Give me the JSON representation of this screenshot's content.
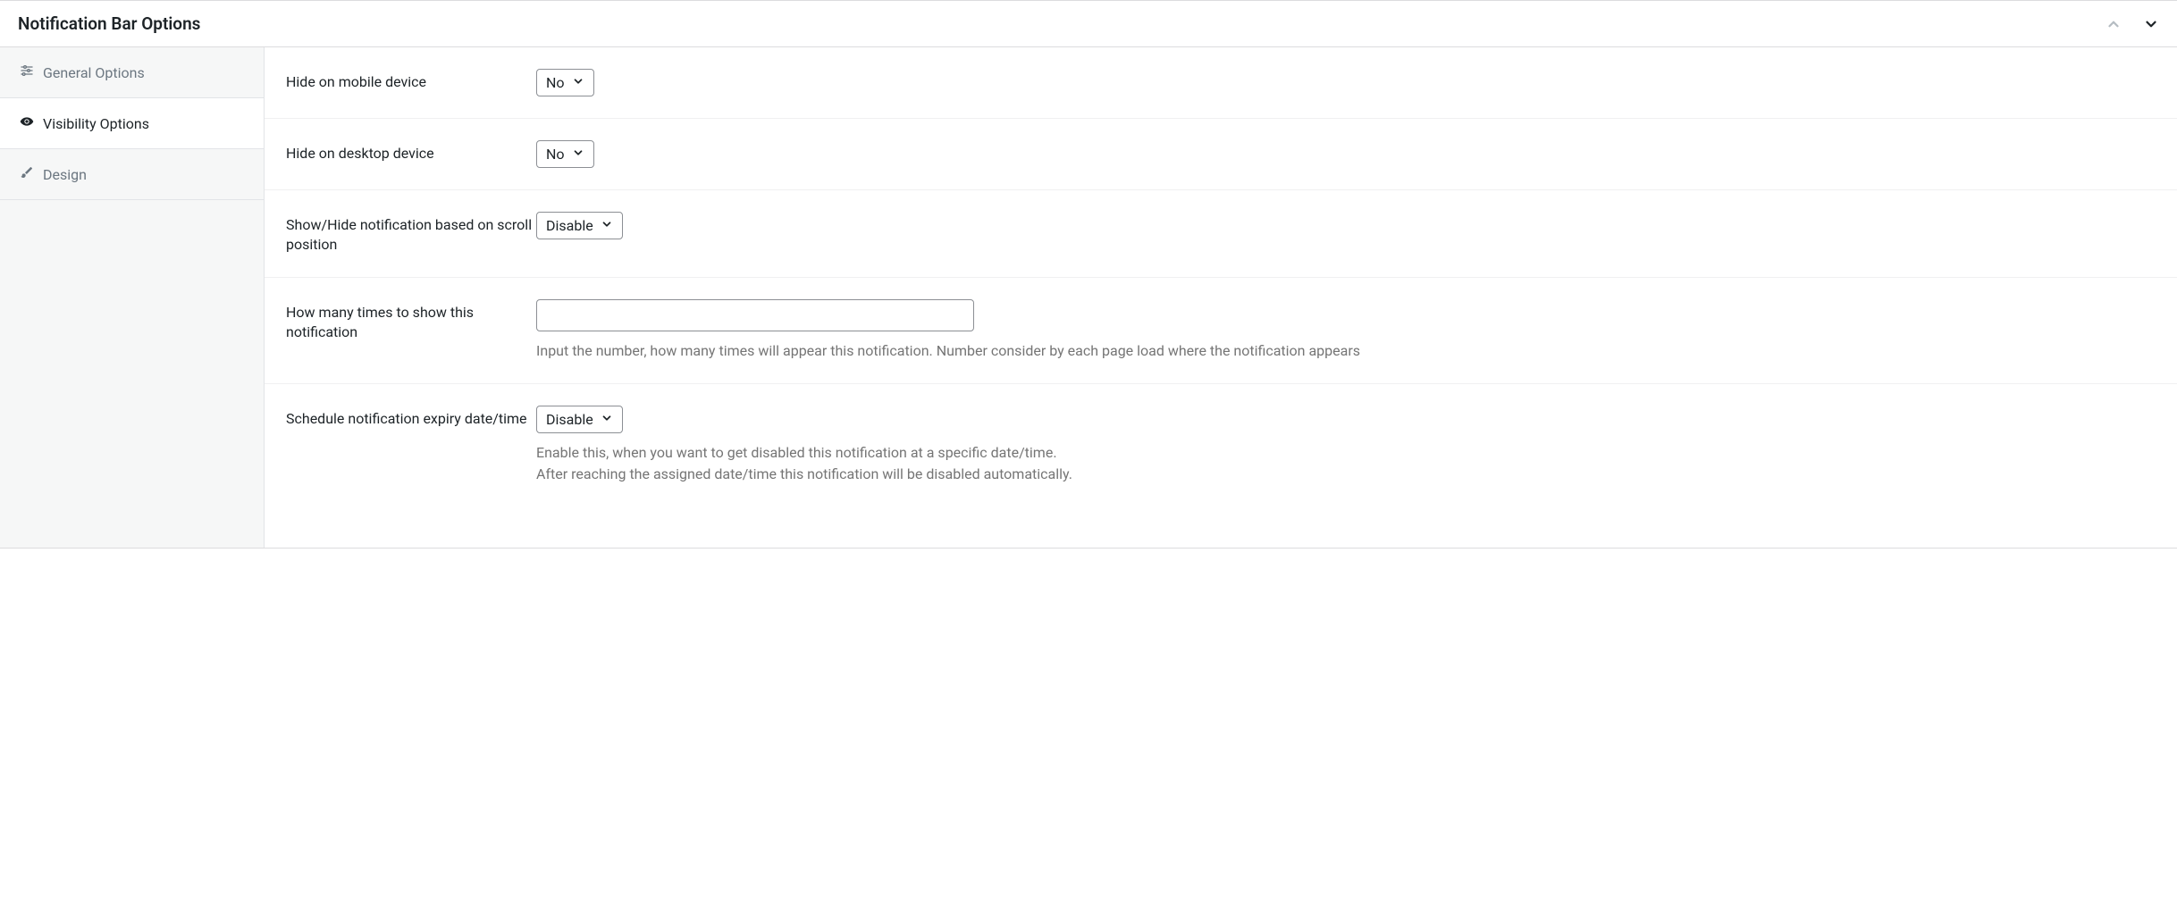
{
  "panel": {
    "title": "Notification Bar Options"
  },
  "sidebar": {
    "items": [
      {
        "label": "General Options"
      },
      {
        "label": "Visibility Options"
      },
      {
        "label": "Design"
      }
    ]
  },
  "fields": {
    "hide_mobile": {
      "label": "Hide on mobile device",
      "value": "No"
    },
    "hide_desktop": {
      "label": "Hide on desktop device",
      "value": "No"
    },
    "scroll_position": {
      "label": "Show/Hide notification based on scroll position",
      "value": "Disable"
    },
    "show_count": {
      "label": "How many times to show this notification",
      "value": "",
      "help": "Input the number, how many times will appear this notification. Number consider by each page load where the notification appears"
    },
    "expiry": {
      "label": "Schedule notification expiry date/time",
      "value": "Disable",
      "help_line1": "Enable this, when you want to get disabled this notification at a specific date/time.",
      "help_line2": "After reaching the assigned date/time this notification will be disabled automatically."
    }
  }
}
